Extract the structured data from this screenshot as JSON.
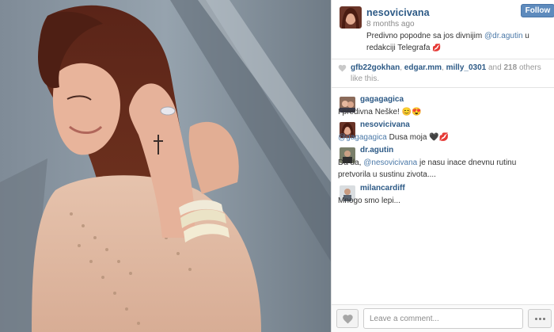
{
  "post": {
    "username": "nesovicivana",
    "follow_label": "Follow",
    "time_ago": "8 months ago",
    "caption": {
      "text_before": "Predivno popodne sa jos divnijim",
      "mention": "@dr.agutin",
      "text_after": "u redakciji Telegrafa",
      "emoji": "💋"
    }
  },
  "likes": {
    "likers": [
      "gfb22gokhan",
      "edgar.mm",
      "milly_0301"
    ],
    "separator_1": ",",
    "separator_2": ",",
    "and_text": "and",
    "others_count": "218",
    "others_text": "others like this."
  },
  "comments": [
    {
      "username": "gagagagica",
      "text": "I predivna Neške! 😊😍"
    },
    {
      "username": "nesovicivana",
      "mention": "@gagagagica",
      "text": "Dusa moja 🖤💋"
    },
    {
      "username": "dr.agutin",
      "text_before": "Da da,",
      "mention": "@nesovicivana",
      "text": "je nasu inace dnevnu rutinu pretvorila u sustinu zivota...."
    },
    {
      "username": "milancardiff",
      "text": "Mnogo smo lepi..."
    }
  ],
  "footer": {
    "comment_placeholder": "Leave a comment...",
    "like_icon": "heart-icon",
    "more_icon": "ellipsis-icon"
  },
  "colors": {
    "link": "#2d5a86",
    "follow_button": "#5e8bbd",
    "muted": "#999999"
  }
}
